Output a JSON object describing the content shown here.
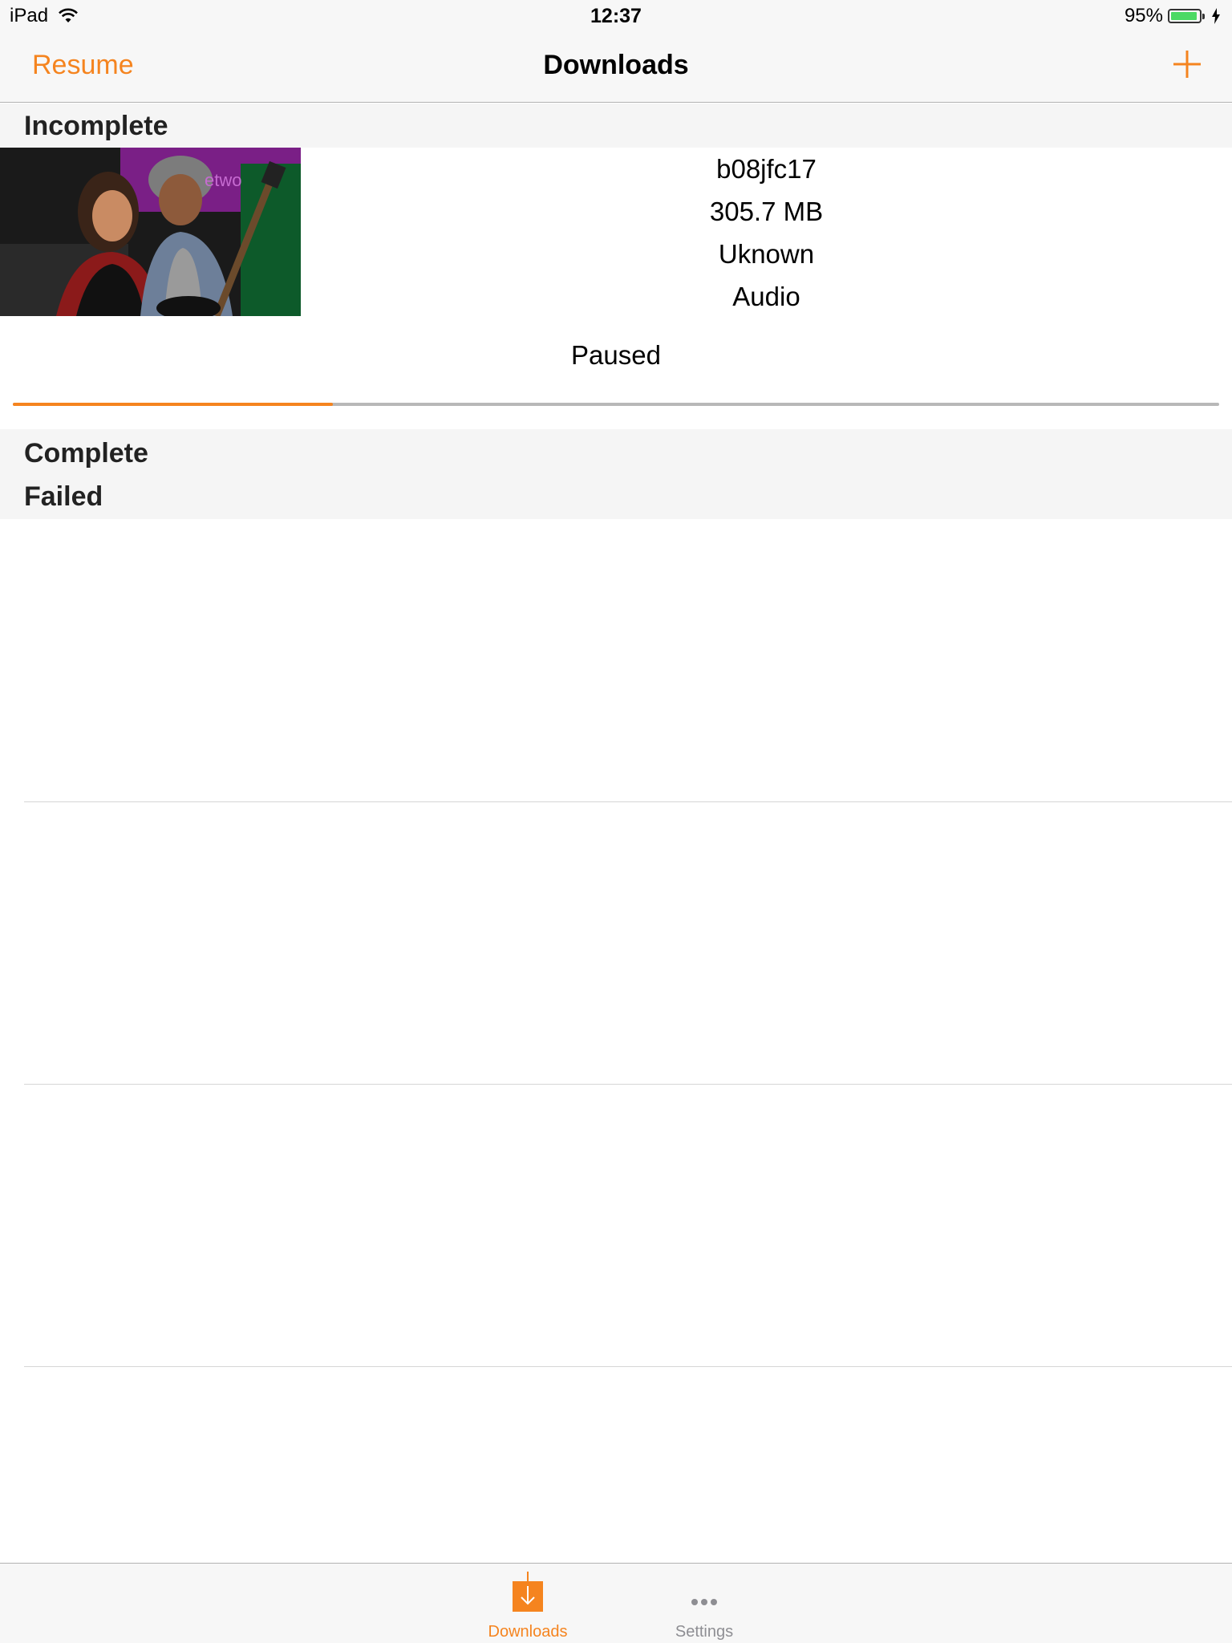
{
  "status_bar": {
    "device": "iPad",
    "time": "12:37",
    "battery": "95%",
    "battery_level": 0.95
  },
  "nav": {
    "left_button": "Resume",
    "title": "Downloads",
    "right_icon": "plus-icon"
  },
  "sections": {
    "incomplete": "Incomplete",
    "complete": "Complete",
    "failed": "Failed"
  },
  "download": {
    "name": "b08jfc17",
    "size": "305.7 MB",
    "duration": "Uknown",
    "type": "Audio",
    "status": "Paused",
    "progress": 0.265
  },
  "tabs": [
    {
      "label": "Downloads",
      "icon": "download-arrow-icon",
      "active": true
    },
    {
      "label": "Settings",
      "icon": "more-dots-icon",
      "active": false
    }
  ],
  "colors": {
    "accent": "#f5841f",
    "inactive_tab": "#8e8e93"
  }
}
